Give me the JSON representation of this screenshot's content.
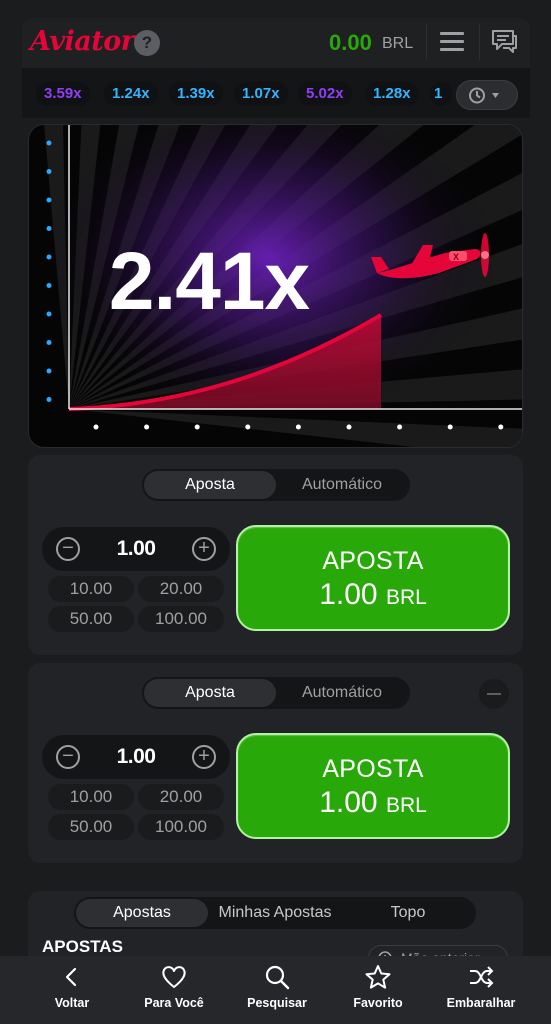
{
  "header": {
    "logo": "Aviator",
    "help": "?",
    "balance": "0.00",
    "currency": "BRL"
  },
  "history": [
    {
      "value": "3.59x",
      "color": "#913ef8"
    },
    {
      "value": "1.24x",
      "color": "#34b4ff"
    },
    {
      "value": "1.39x",
      "color": "#34b4ff"
    },
    {
      "value": "1.07x",
      "color": "#34b4ff"
    },
    {
      "value": "5.02x",
      "color": "#913ef8"
    },
    {
      "value": "1.28x",
      "color": "#34b4ff"
    },
    {
      "value": "1",
      "color": "#34b4ff"
    }
  ],
  "game": {
    "multiplier": "2.41x",
    "accent": "#e50539"
  },
  "bet_panels": [
    {
      "tabs": [
        "Aposta",
        "Automático"
      ],
      "active_tab": "Aposta",
      "stake": "1.00",
      "minus": "−",
      "plus": "+",
      "quick": [
        "10.00",
        "20.00",
        "50.00",
        "100.00"
      ],
      "button_line1": "APOSTA",
      "button_amount": "1.00",
      "button_currency": "BRL"
    },
    {
      "tabs": [
        "Aposta",
        "Automático"
      ],
      "active_tab": "Aposta",
      "stake": "1.00",
      "minus": "−",
      "plus": "+",
      "quick": [
        "10.00",
        "20.00",
        "50.00",
        "100.00"
      ],
      "button_line1": "APOSTA",
      "button_amount": "1.00",
      "button_currency": "BRL"
    }
  ],
  "bets": {
    "tabs": [
      "Apostas",
      "Minhas Apostas",
      "Topo"
    ],
    "active_tab": "Apostas",
    "title": "APOSTAS",
    "prev_hand": "Mão anterior"
  },
  "bottom_nav": [
    {
      "label": "Voltar",
      "icon": "chevron-left-icon"
    },
    {
      "label": "Para Você",
      "icon": "heart-icon"
    },
    {
      "label": "Pesquisar",
      "icon": "search-icon"
    },
    {
      "label": "Favorito",
      "icon": "star-icon"
    },
    {
      "label": "Embaralhar",
      "icon": "shuffle-icon"
    }
  ]
}
